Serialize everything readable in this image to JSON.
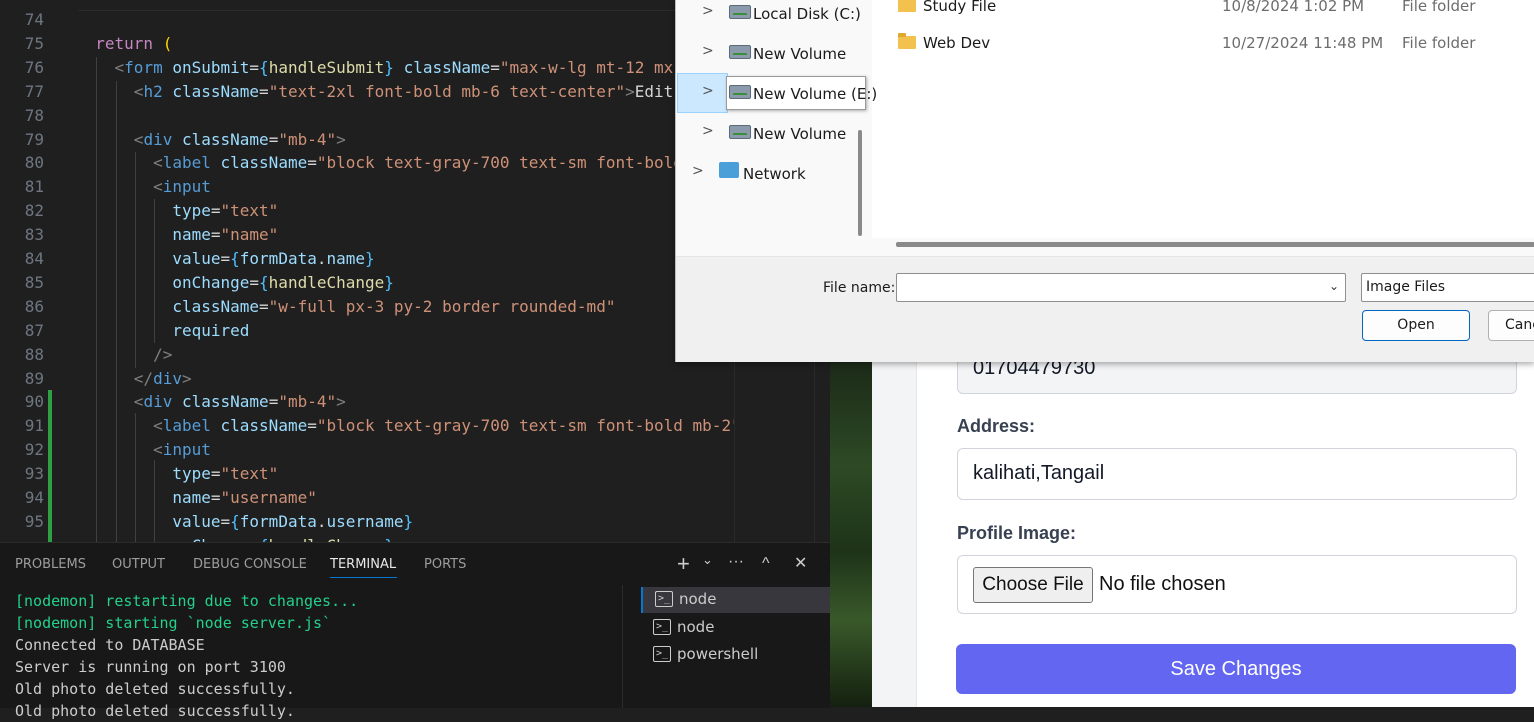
{
  "editor": {
    "lines": [
      {
        "n": "74",
        "html": ""
      },
      {
        "n": "75",
        "html": "  <span class='k'>return</span> <span class='b'>(</span>"
      },
      {
        "n": "76",
        "html": "    <span class='p'>&lt;</span><span class='t'>form</span> <span class='a'>onSubmit</span><span class='w'>=</span><span class='bl'>{</span><span class='f'>handleSubmit</span><span class='bl'>}</span> <span class='a'>className</span><span class='w'>=</span><span class='s'>\"max-w-lg mt-12 mx</span>"
      },
      {
        "n": "77",
        "html": "      <span class='p'>&lt;</span><span class='t'>h2</span> <span class='a'>className</span><span class='w'>=</span><span class='s'>\"text-2xl font-bold mb-6 text-center\"</span><span class='p'>&gt;</span><span class='w'>Edit</span>"
      },
      {
        "n": "78",
        "html": ""
      },
      {
        "n": "79",
        "html": "      <span class='p'>&lt;</span><span class='t'>div</span> <span class='a'>className</span><span class='w'>=</span><span class='s'>\"mb-4\"</span><span class='p'>&gt;</span>"
      },
      {
        "n": "80",
        "html": "        <span class='p'>&lt;</span><span class='t'>label</span> <span class='a'>className</span><span class='w'>=</span><span class='s'>\"block text-gray-700 text-sm font-bold</span>"
      },
      {
        "n": "81",
        "html": "        <span class='p'>&lt;</span><span class='t'>input</span>"
      },
      {
        "n": "82",
        "html": "          <span class='a'>type</span><span class='w'>=</span><span class='s'>\"text\"</span>"
      },
      {
        "n": "83",
        "html": "          <span class='a'>name</span><span class='w'>=</span><span class='s'>\"name\"</span>"
      },
      {
        "n": "84",
        "html": "          <span class='a'>value</span><span class='w'>=</span><span class='bl'>{</span><span class='a'>formData</span><span class='w'>.</span><span class='a'>name</span><span class='bl'>}</span>"
      },
      {
        "n": "85",
        "html": "          <span class='a'>onChange</span><span class='w'>=</span><span class='bl'>{</span><span class='f'>handleChange</span><span class='bl'>}</span>"
      },
      {
        "n": "86",
        "html": "          <span class='a'>className</span><span class='w'>=</span><span class='s'>\"w-full px-3 py-2 border rounded-md\"</span>"
      },
      {
        "n": "87",
        "html": "          <span class='a'>required</span>"
      },
      {
        "n": "88",
        "html": "        <span class='p'>/&gt;</span>"
      },
      {
        "n": "89",
        "html": "      <span class='p'>&lt;/</span><span class='t'>div</span><span class='p'>&gt;</span>"
      },
      {
        "n": "90",
        "html": "      <span class='p'>&lt;</span><span class='t'>div</span> <span class='a'>className</span><span class='w'>=</span><span class='s'>\"mb-4\"</span><span class='p'>&gt;</span>",
        "mark": true
      },
      {
        "n": "91",
        "html": "        <span class='p'>&lt;</span><span class='t'>label</span> <span class='a'>className</span><span class='w'>=</span><span class='s'>\"block text-gray-700 text-sm font-bold mb-2\"</span>",
        "mark": true
      },
      {
        "n": "92",
        "html": "        <span class='p'>&lt;</span><span class='t'>input</span>",
        "mark": true
      },
      {
        "n": "93",
        "html": "          <span class='a'>type</span><span class='w'>=</span><span class='s'>\"text\"</span>",
        "mark": true
      },
      {
        "n": "94",
        "html": "          <span class='a'>name</span><span class='w'>=</span><span class='s'>\"username\"</span>",
        "mark": true
      },
      {
        "n": "95",
        "html": "          <span class='a'>value</span><span class='w'>=</span><span class='bl'>{</span><span class='a'>formData</span><span class='w'>.</span><span class='a'>username</span><span class='bl'>}</span>",
        "mark": true
      },
      {
        "n": "",
        "html": "          <span class='a'>onChange</span><span class='w'>=</span><span class='bl'>{</span><span class='f'>handleChange</span><span class='bl'>}</span>",
        "mark": true
      }
    ]
  },
  "panel": {
    "tabs": [
      "PROBLEMS",
      "OUTPUT",
      "DEBUG CONSOLE",
      "TERMINAL",
      "PORTS"
    ],
    "active_tab": "TERMINAL",
    "actions": {
      "add": "+",
      "add_dropdown": "⌄",
      "more": "···",
      "maximize": "^",
      "close": "✕"
    },
    "terminal_lines": [
      {
        "text": "[nodemon] restarting due to changes...",
        "green": true
      },
      {
        "text": "[nodemon] starting `node server.js`",
        "green": true
      },
      {
        "text": "Connected to DATABASE",
        "green": false
      },
      {
        "text": "Server is running on port 3100",
        "green": false
      },
      {
        "text": "Old photo deleted successfully.",
        "green": false
      },
      {
        "text": "Old photo deleted successfully.",
        "green": false
      }
    ],
    "terminals": [
      {
        "name": "node",
        "selected": true
      },
      {
        "name": "node",
        "selected": false
      },
      {
        "name": "powershell",
        "selected": false
      }
    ]
  },
  "dialog": {
    "nav": [
      {
        "label": "Local Disk (C:)",
        "type": "drive"
      },
      {
        "label": "New Volume (D:)",
        "type": "drive"
      },
      {
        "label": "New Volume (E:)",
        "type": "drive",
        "selected": true
      },
      {
        "label": "New Volume (F:)",
        "type": "drive"
      },
      {
        "label": "Network",
        "type": "network"
      }
    ],
    "files": [
      {
        "name": "Study File",
        "date": "10/8/2024 1:02 PM",
        "type": "File folder"
      },
      {
        "name": "Web Dev",
        "date": "10/27/2024 11:48 PM",
        "type": "File folder"
      }
    ],
    "file_name_label": "File name:",
    "file_name_value": "",
    "file_type": "Image Files",
    "open_label": "Open",
    "cancel_label": "Cancel"
  },
  "form": {
    "phone_value": "01704479730",
    "address_label": "Address:",
    "address_value": "kalihati,Tangail",
    "profile_label": "Profile Image:",
    "choose_file_label": "Choose File",
    "no_file_label": "No file chosen",
    "save_label": "Save Changes"
  },
  "colors": {
    "accent": "#6366f1",
    "terminal_green": "#23d18b",
    "vscode_blue": "#0078d4"
  }
}
